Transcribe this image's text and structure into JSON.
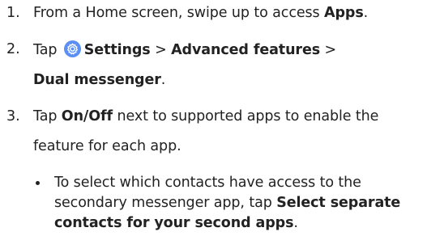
{
  "steps": [
    {
      "number": "1.",
      "lines": [
        {
          "pre": "From a Home screen, swipe up to access ",
          "bold": "Apps",
          "post": "."
        }
      ]
    },
    {
      "number": "2.",
      "line1": {
        "pre": "Tap ",
        "bold_a": "Settings",
        "sep1": " > ",
        "bold_b": "Advanced features",
        "sep2": " >"
      },
      "line2": {
        "bold": "Dual messenger",
        "post": "."
      }
    },
    {
      "number": "3.",
      "line1": {
        "pre": "Tap ",
        "bold": "On/Off",
        "post": " next to supported apps to enable the"
      },
      "line2": {
        "text": "feature for each app."
      }
    }
  ],
  "bullet": {
    "line1": "To select which contacts have access to the",
    "line2": {
      "pre": "secondary messenger app, tap ",
      "bold": "Select separate"
    },
    "line3": {
      "bold": "contacts for your second apps",
      "post": "."
    }
  },
  "icons": {
    "settings": "settings-gear-icon"
  },
  "colors": {
    "text": "#222222",
    "settings_icon_bg": "#5b8ff3",
    "settings_icon_fg": "#ffffff"
  }
}
